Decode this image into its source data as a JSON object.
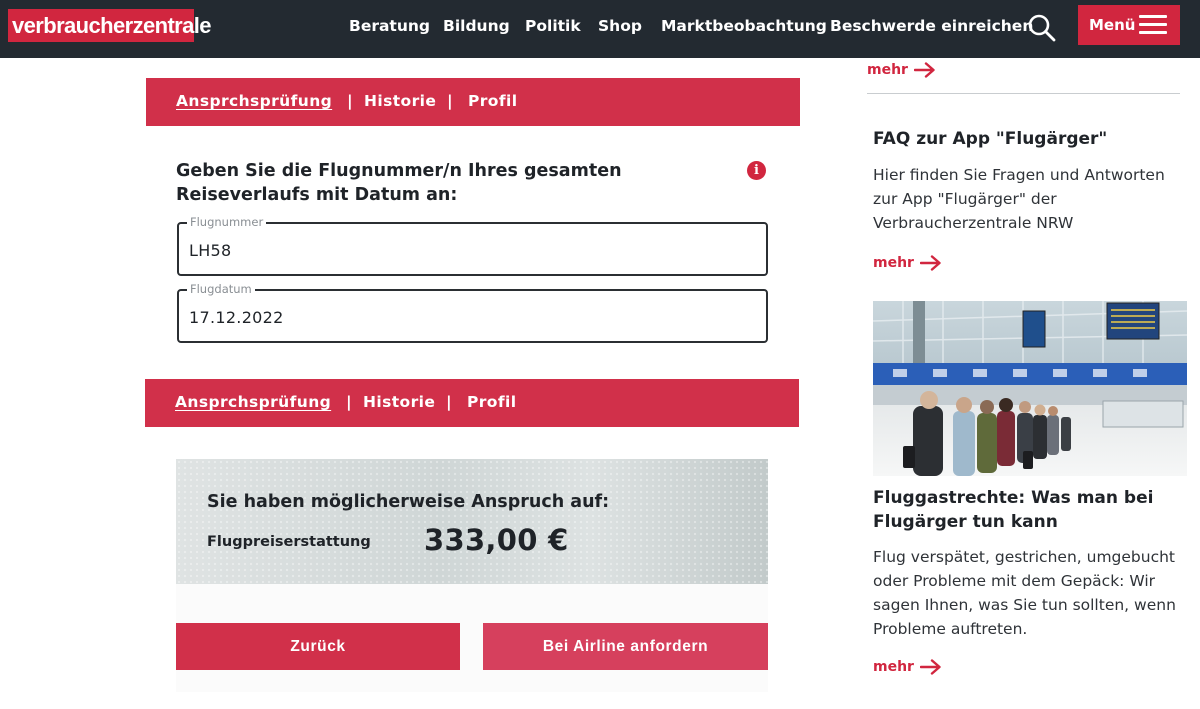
{
  "header": {
    "logo_text": "verbraucherzentrale",
    "nav": [
      "Beratung",
      "Bildung",
      "Politik",
      "Shop",
      "Marktbeobachtung",
      "Beschwerde einreichen"
    ],
    "search_icon": "search-icon",
    "menu_label": "Menü",
    "menu_icon": "hamburger-icon"
  },
  "tabs": {
    "items": [
      "Ansprchsprüfung",
      "Historie",
      "Profil"
    ],
    "separator": "|",
    "active_index": 0
  },
  "form": {
    "question": "Geben Sie die Flugnummer/n Ihres gesamten Reiseverlaufs mit Datum an:",
    "info_icon": "i",
    "flight_number": {
      "label": "Flugnummer",
      "value": "LH58"
    },
    "flight_date": {
      "label": "Flugdatum",
      "value": "17.12.2022"
    }
  },
  "result": {
    "title": "Sie haben möglicherweise Anspruch auf:",
    "label": "Flugpreiserstattung",
    "amount": "333,00 €"
  },
  "buttons": {
    "back": "Zurück",
    "request": "Bei Airline anfordern"
  },
  "sidebar": {
    "more_label": "mehr",
    "faq": {
      "title": "FAQ zur App \"Flugärger\"",
      "text": "Hier finden Sie Fragen und Antworten zur App \"Flugärger\" der Verbraucherzentrale NRW"
    },
    "article": {
      "title": "Fluggastrechte: Was man bei Flugärger tun kann",
      "text": "Flug verspätet, gestrichen, umgebucht oder Probleme mit dem Gepäck: Wir sagen Ihnen, was Sie tun sollten, wenn Probleme auftreten."
    }
  },
  "colors": {
    "brand_red": "#d1263f",
    "header_bg": "#232a31"
  }
}
